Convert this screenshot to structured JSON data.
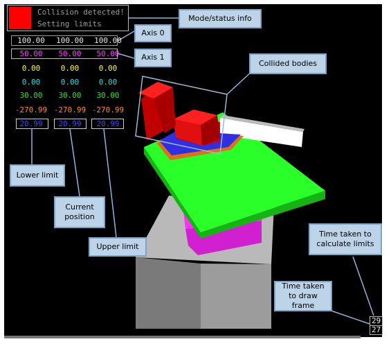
{
  "status": {
    "line1": "Collision detected!",
    "line2": "Setting limits",
    "indicator_color": "#ff0000"
  },
  "rows": [
    {
      "values": [
        "100.00",
        "100.00",
        "100.00"
      ],
      "color": "#e8e8e8"
    },
    {
      "values": [
        "50.00",
        "50.00",
        "50.00"
      ],
      "color": "#ff3cff"
    },
    {
      "values": [
        "0.00",
        "0.00",
        "0.00"
      ],
      "color": "#ffff20"
    },
    {
      "values": [
        "0.00",
        "0.00",
        "0.00"
      ],
      "color": "#20e0e0"
    },
    {
      "values": [
        "30.00",
        "30.00",
        "30.00"
      ],
      "color": "#30e030"
    },
    {
      "values": [
        "-270.99",
        "-270.99",
        "-270.99"
      ],
      "color": "#ff8a20"
    },
    {
      "values": [
        "20.99",
        "20.99",
        "20.99"
      ],
      "color": "#4040ff"
    }
  ],
  "callouts": {
    "mode_status": "Mode/status info",
    "axis0": "Axis 0",
    "axis1": "Axis 1",
    "collided": "Collided bodies",
    "lower_limit": "Lower limit",
    "current_position": "Current position",
    "upper_limit": "Upper limit",
    "time_limits": "Time taken to calculate limits",
    "time_draw": "Time taken to draw frame"
  },
  "timings": {
    "limits_ms": "29",
    "draw_ms": "27"
  }
}
